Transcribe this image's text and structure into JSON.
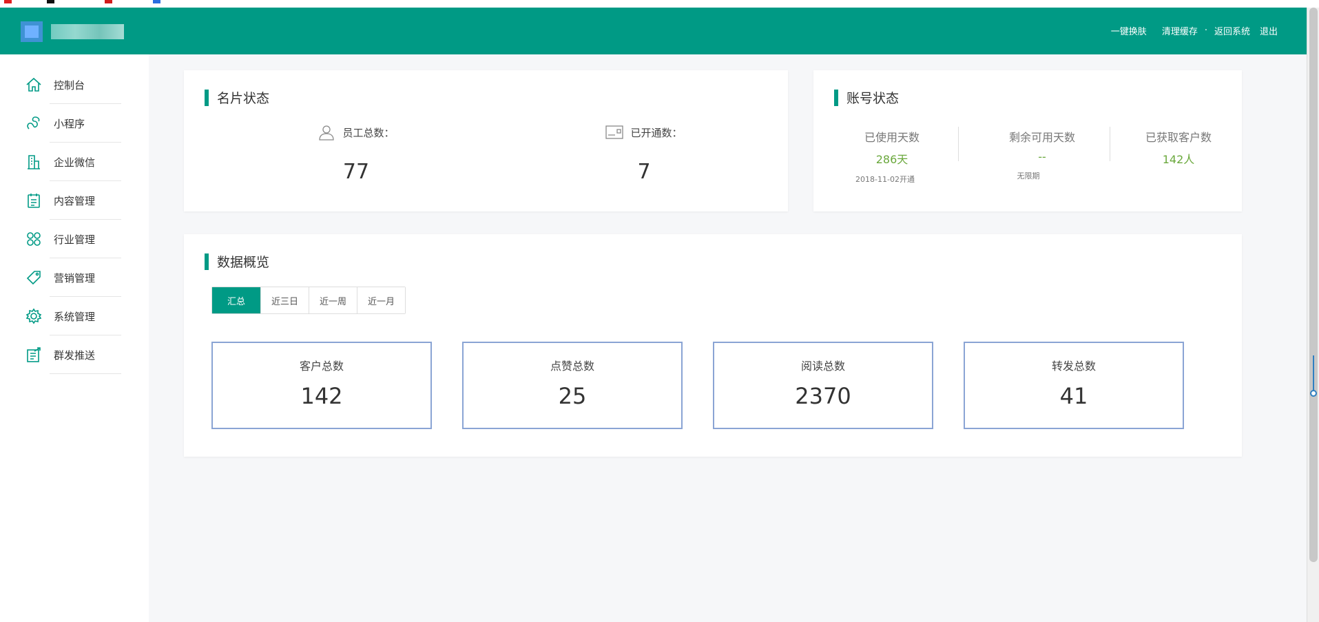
{
  "header": {
    "nav": [
      "一键换肤",
      "清理缓存",
      "返回系统",
      "退出"
    ]
  },
  "sidebar": {
    "items": [
      {
        "label": "控制台",
        "icon": "home-icon"
      },
      {
        "label": "小程序",
        "icon": "miniapp-icon"
      },
      {
        "label": "企业微信",
        "icon": "building-icon"
      },
      {
        "label": "内容管理",
        "icon": "clipboard-icon"
      },
      {
        "label": "行业管理",
        "icon": "grid-icon"
      },
      {
        "label": "营销管理",
        "icon": "tag-icon"
      },
      {
        "label": "系统管理",
        "icon": "gear-icon"
      },
      {
        "label": "群发推送",
        "icon": "send-icon"
      }
    ]
  },
  "card_status": {
    "title": "名片状态",
    "employees_label": "员工总数：",
    "employees_value": "77",
    "opened_label": "已开通数：",
    "opened_value": "7"
  },
  "account_status": {
    "title": "账号状态",
    "columns": [
      {
        "label": "已使用天数",
        "value": "286天",
        "sub": "2018-11-02开通"
      },
      {
        "label": "剩余可用天数",
        "value": "--",
        "sub": "无限期"
      },
      {
        "label": "已获取客户数",
        "value": "142人",
        "sub": ""
      }
    ]
  },
  "data_overview": {
    "title": "数据概览",
    "tabs": [
      "汇总",
      "近三日",
      "近一周",
      "近一月"
    ],
    "active_tab": "汇总",
    "metrics": [
      {
        "label": "客户总数",
        "value": "142"
      },
      {
        "label": "点赞总数",
        "value": "25"
      },
      {
        "label": "阅读总数",
        "value": "2370"
      },
      {
        "label": "转发总数",
        "value": "41"
      }
    ]
  },
  "colors": {
    "brand": "#009a85",
    "value_green": "#6aa83c",
    "metric_border": "#8aa4d4"
  }
}
